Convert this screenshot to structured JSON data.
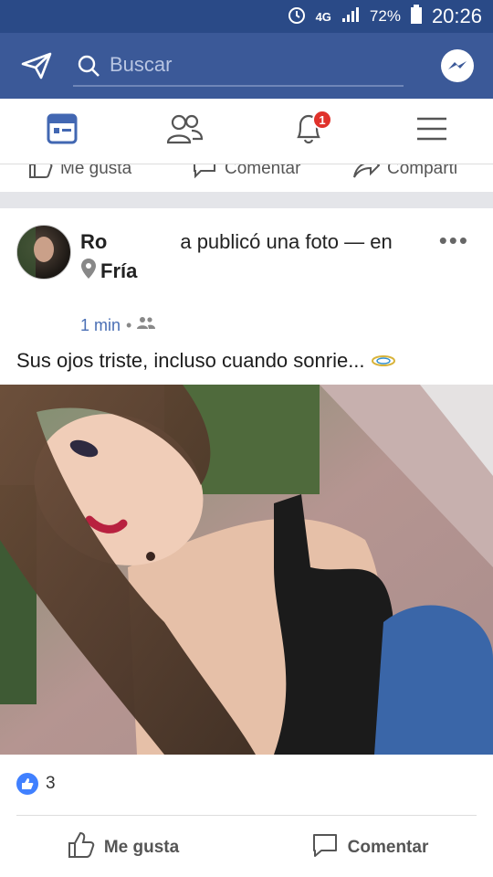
{
  "status": {
    "alarm_icon": "alarm-icon",
    "network": "4G",
    "battery": "72%",
    "time": "20:26"
  },
  "appbar": {
    "search_placeholder": "Buscar",
    "accent": "#3b5998"
  },
  "tabs": [
    {
      "name": "feed",
      "icon": "news-feed-icon"
    },
    {
      "name": "friends",
      "icon": "friends-icon"
    },
    {
      "name": "notifications",
      "icon": "bell-icon",
      "badge": "1"
    },
    {
      "name": "menu",
      "icon": "menu-icon"
    }
  ],
  "prev_post": {
    "like": "Me gusta",
    "comment": "Comentar",
    "share": "Comparti"
  },
  "post": {
    "author_start": "Ro",
    "author_end": "a",
    "action": " publicó una foto — en",
    "location": "Fría",
    "time": "1 min",
    "caption": "Sus ojos triste, incluso cuando sonrie...",
    "reaction_count": "3",
    "like_label": "Me gusta",
    "comment_label": "Comentar"
  }
}
